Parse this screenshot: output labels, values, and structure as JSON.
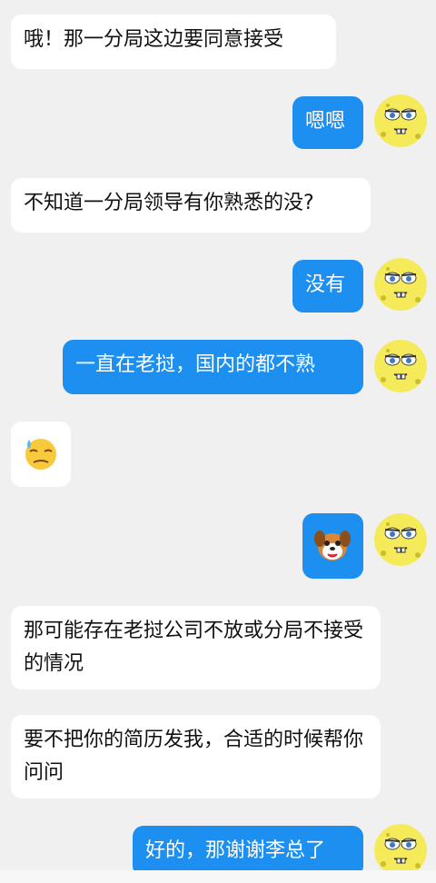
{
  "messages": [
    {
      "side": "left",
      "text": "哦！那一分局这边要同意接受"
    },
    {
      "side": "right",
      "text": "嗯嗯"
    },
    {
      "side": "left",
      "text": "不知道一分局领导有你熟悉的没?"
    },
    {
      "side": "right",
      "text": "没有"
    },
    {
      "side": "right",
      "text": "一直在老挝，国内的都不熟"
    },
    {
      "side": "left",
      "emoji": "sweat-face"
    },
    {
      "side": "right",
      "emoji": "dog-sticker"
    },
    {
      "side": "left",
      "text": "那可能存在老挝公司不放或分局不接受的情况"
    },
    {
      "side": "left",
      "text": "要不把你的简历发我，合适的时候帮你问问"
    },
    {
      "side": "right",
      "text": "好的，那谢谢李总了"
    }
  ],
  "colors": {
    "right_bubble": "#1d8ff0",
    "left_bubble": "#ffffff",
    "background": "#f0f0f0"
  },
  "avatar_icon": "spongebob-avatar-icon"
}
